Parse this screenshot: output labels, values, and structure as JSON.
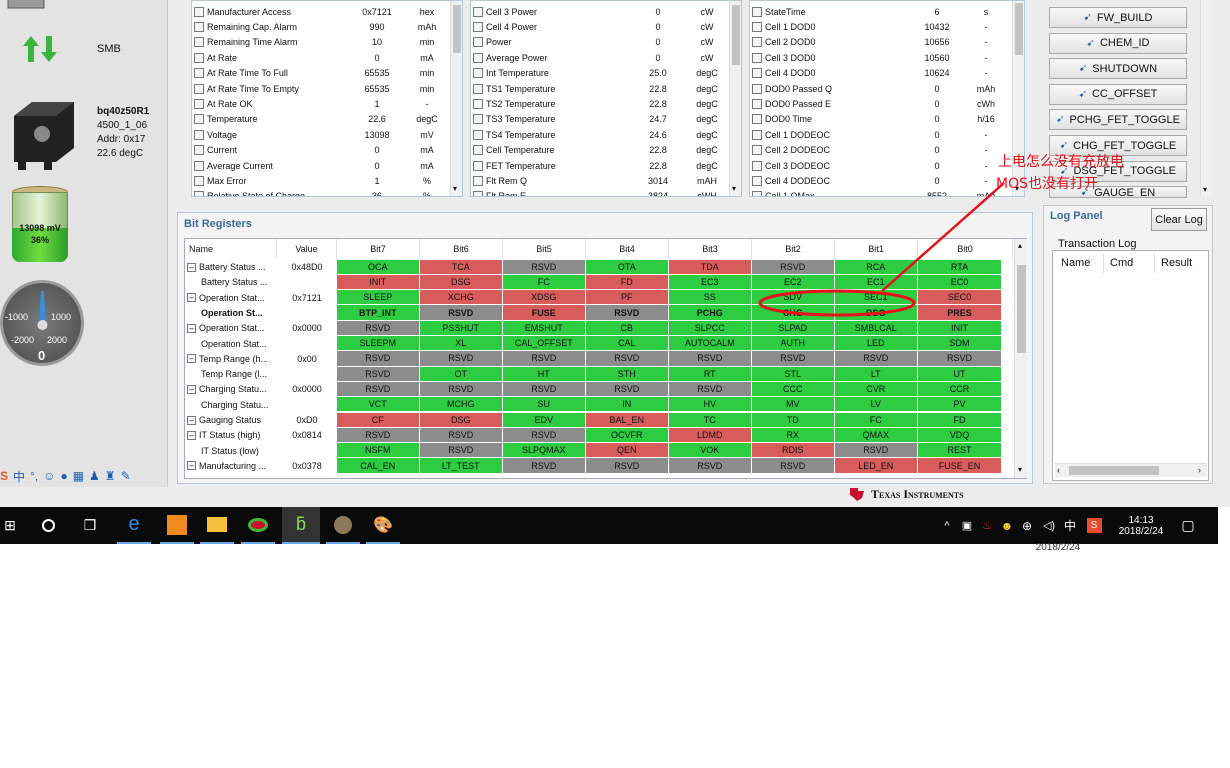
{
  "device": {
    "protocol": "SMB",
    "name": "bq40z50R1",
    "firmware": "4500_1_06",
    "addr": "Addr: 0x17",
    "temp": "22.6 degC",
    "battery_voltage": "13098 mV",
    "battery_soc": "36%",
    "gauge_labels": [
      "-1000",
      "1000",
      "-2000",
      "2000",
      "0"
    ]
  },
  "col1": [
    {
      "name": "Manufacturer Access",
      "value": "0x7121",
      "unit": "hex"
    },
    {
      "name": "Remaining Cap. Alarm",
      "value": "990",
      "unit": "mAh"
    },
    {
      "name": "Remaining Time Alarm",
      "value": "10",
      "unit": "min"
    },
    {
      "name": "At Rate",
      "value": "0",
      "unit": "mA"
    },
    {
      "name": "At Rate Time To Full",
      "value": "65535",
      "unit": "min"
    },
    {
      "name": "At Rate Time To Empty",
      "value": "65535",
      "unit": "min"
    },
    {
      "name": "At Rate OK",
      "value": "1",
      "unit": "-"
    },
    {
      "name": "Temperature",
      "value": "22.6",
      "unit": "degC"
    },
    {
      "name": "Voltage",
      "value": "13098",
      "unit": "mV"
    },
    {
      "name": "Current",
      "value": "0",
      "unit": "mA"
    },
    {
      "name": "Average Current",
      "value": "0",
      "unit": "mA"
    },
    {
      "name": "Max Error",
      "value": "1",
      "unit": "%"
    },
    {
      "name": "Relative State of Charge",
      "value": "36",
      "unit": "%"
    }
  ],
  "col2": [
    {
      "name": "Cell 3 Power",
      "value": "0",
      "unit": "cW"
    },
    {
      "name": "Cell 4 Power",
      "value": "0",
      "unit": "cW"
    },
    {
      "name": "Power",
      "value": "0",
      "unit": "cW"
    },
    {
      "name": "Average Power",
      "value": "0",
      "unit": "cW"
    },
    {
      "name": "Int Temperature",
      "value": "25.0",
      "unit": "degC"
    },
    {
      "name": "TS1 Temperature",
      "value": "22.8",
      "unit": "degC"
    },
    {
      "name": "TS2 Temperature",
      "value": "22.8",
      "unit": "degC"
    },
    {
      "name": "TS3 Temperature",
      "value": "24.7",
      "unit": "degC"
    },
    {
      "name": "TS4 Temperature",
      "value": "24.6",
      "unit": "degC"
    },
    {
      "name": "Cell Temperature",
      "value": "22.8",
      "unit": "degC"
    },
    {
      "name": "FET Temperature",
      "value": "22.8",
      "unit": "degC"
    },
    {
      "name": "Flt Rem Q",
      "value": "3014",
      "unit": "mAH"
    },
    {
      "name": "Flt Rem E",
      "value": "3824",
      "unit": "cWH"
    }
  ],
  "col3": [
    {
      "name": "StateTime",
      "value": "6",
      "unit": "s"
    },
    {
      "name": "Cell 1 DOD0",
      "value": "10432",
      "unit": "-"
    },
    {
      "name": "Cell 2 DOD0",
      "value": "10656",
      "unit": "-"
    },
    {
      "name": "Cell 3 DOD0",
      "value": "10560",
      "unit": "-"
    },
    {
      "name": "Cell 4 DOD0",
      "value": "10624",
      "unit": "-"
    },
    {
      "name": "DOD0 Passed Q",
      "value": "0",
      "unit": "mAh"
    },
    {
      "name": "DOD0 Passed E",
      "value": "0",
      "unit": "cWh"
    },
    {
      "name": "DOD0 Time",
      "value": "0",
      "unit": "h/16"
    },
    {
      "name": "Cell 1 DODEOC",
      "value": "0",
      "unit": "-"
    },
    {
      "name": "Cell 2 DODEOC",
      "value": "0",
      "unit": "-"
    },
    {
      "name": "Cell 3 DODEOC",
      "value": "0",
      "unit": "-"
    },
    {
      "name": "Cell 4 DODEOC",
      "value": "0",
      "unit": "-"
    },
    {
      "name": "Cell 1 QMax",
      "value": "8552",
      "unit": "mAh"
    }
  ],
  "commands": [
    "FW_BUILD",
    "CHEM_ID",
    "SHUTDOWN",
    "CC_OFFSET",
    "PCHG_FET_TOGGLE",
    "CHG_FET_TOGGLE",
    "DSG_FET_TOGGLE",
    "GAUGE_EN"
  ],
  "bit_registers": {
    "title": "Bit Registers",
    "headers": [
      "Name",
      "Value",
      "Bit7",
      "Bit6",
      "Bit5",
      "Bit4",
      "Bit3",
      "Bit2",
      "Bit1",
      "Bit0"
    ],
    "rows": [
      {
        "name": "Battery Status ...",
        "value": "0x48D0",
        "expand": true,
        "bold": false,
        "bits": [
          [
            "OCA",
            "g"
          ],
          [
            "TCA",
            "r"
          ],
          [
            "RSVD",
            "y"
          ],
          [
            "OTA",
            "g"
          ],
          [
            "TDA",
            "r"
          ],
          [
            "RSVD",
            "y"
          ],
          [
            "RCA",
            "g"
          ],
          [
            "RTA",
            "g"
          ]
        ]
      },
      {
        "name": "Battery Status ...",
        "value": "",
        "expand": false,
        "bold": false,
        "bits": [
          [
            "INIT",
            "r"
          ],
          [
            "DSG",
            "r"
          ],
          [
            "FC",
            "g"
          ],
          [
            "FD",
            "r"
          ],
          [
            "EC3",
            "g"
          ],
          [
            "EC2",
            "g"
          ],
          [
            "EC1",
            "g"
          ],
          [
            "EC0",
            "g"
          ]
        ]
      },
      {
        "name": "Operation Stat...",
        "value": "0x7121",
        "expand": true,
        "bold": false,
        "bits": [
          [
            "SLEEP",
            "g"
          ],
          [
            "XCHG",
            "r"
          ],
          [
            "XDSG",
            "r"
          ],
          [
            "PF",
            "r"
          ],
          [
            "SS",
            "g"
          ],
          [
            "SDV",
            "g"
          ],
          [
            "SEC1",
            "g"
          ],
          [
            "SEC0",
            "r"
          ]
        ]
      },
      {
        "name": "Operation St...",
        "value": "",
        "expand": false,
        "bold": true,
        "bits": [
          [
            "BTP_INT",
            "g"
          ],
          [
            "RSVD",
            "y"
          ],
          [
            "FUSE",
            "r"
          ],
          [
            "RSVD",
            "y"
          ],
          [
            "PCHG",
            "g"
          ],
          [
            "CHG",
            "g"
          ],
          [
            "DSG",
            "g"
          ],
          [
            "PRES",
            "r"
          ]
        ]
      },
      {
        "name": "Operation Stat...",
        "value": "0x0000",
        "expand": true,
        "bold": false,
        "bits": [
          [
            "RSVD",
            "y"
          ],
          [
            "PSSHUT",
            "g"
          ],
          [
            "EMSHUT",
            "g"
          ],
          [
            "CB",
            "g"
          ],
          [
            "SLPCC",
            "g"
          ],
          [
            "SLPAD",
            "g"
          ],
          [
            "SMBLCAL",
            "g"
          ],
          [
            "INIT",
            "g"
          ]
        ]
      },
      {
        "name": "Operation Stat...",
        "value": "",
        "expand": false,
        "bold": false,
        "bits": [
          [
            "SLEEPM",
            "g"
          ],
          [
            "XL",
            "g"
          ],
          [
            "CAL_OFFSET",
            "g"
          ],
          [
            "CAL",
            "g"
          ],
          [
            "AUTOCALM",
            "g"
          ],
          [
            "AUTH",
            "g"
          ],
          [
            "LED",
            "g"
          ],
          [
            "SDM",
            "g"
          ]
        ]
      },
      {
        "name": "Temp Range (h...",
        "value": "0x00",
        "expand": true,
        "bold": false,
        "bits": [
          [
            "RSVD",
            "y"
          ],
          [
            "RSVD",
            "y"
          ],
          [
            "RSVD",
            "y"
          ],
          [
            "RSVD",
            "y"
          ],
          [
            "RSVD",
            "y"
          ],
          [
            "RSVD",
            "y"
          ],
          [
            "RSVD",
            "y"
          ],
          [
            "RSVD",
            "y"
          ]
        ]
      },
      {
        "name": "Temp Range (l...",
        "value": "",
        "expand": false,
        "bold": false,
        "bits": [
          [
            "RSVD",
            "y"
          ],
          [
            "OT",
            "g"
          ],
          [
            "HT",
            "g"
          ],
          [
            "STH",
            "g"
          ],
          [
            "RT",
            "g"
          ],
          [
            "STL",
            "g"
          ],
          [
            "LT",
            "g"
          ],
          [
            "UT",
            "g"
          ]
        ]
      },
      {
        "name": "Charging Statu...",
        "value": "0x0000",
        "expand": true,
        "bold": false,
        "bits": [
          [
            "RSVD",
            "y"
          ],
          [
            "RSVD",
            "y"
          ],
          [
            "RSVD",
            "y"
          ],
          [
            "RSVD",
            "y"
          ],
          [
            "RSVD",
            "y"
          ],
          [
            "CCC",
            "g"
          ],
          [
            "CVR",
            "g"
          ],
          [
            "CCR",
            "g"
          ]
        ]
      },
      {
        "name": "Charging Statu...",
        "value": "",
        "expand": false,
        "bold": false,
        "bits": [
          [
            "VCT",
            "g"
          ],
          [
            "MCHG",
            "g"
          ],
          [
            "SU",
            "g"
          ],
          [
            "IN",
            "g"
          ],
          [
            "HV",
            "g"
          ],
          [
            "MV",
            "g"
          ],
          [
            "LV",
            "g"
          ],
          [
            "PV",
            "g"
          ]
        ]
      },
      {
        "name": "Gauging Status",
        "value": "0xD0",
        "expand": true,
        "bold": false,
        "bits": [
          [
            "CF",
            "r"
          ],
          [
            "DSG",
            "r"
          ],
          [
            "EDV",
            "g"
          ],
          [
            "BAL_EN",
            "r"
          ],
          [
            "TC",
            "g"
          ],
          [
            "TD",
            "g"
          ],
          [
            "FC",
            "g"
          ],
          [
            "FD",
            "g"
          ]
        ]
      },
      {
        "name": "IT Status (high)",
        "value": "0x0814",
        "expand": true,
        "bold": false,
        "bits": [
          [
            "RSVD",
            "y"
          ],
          [
            "RSVD",
            "y"
          ],
          [
            "RSVD",
            "y"
          ],
          [
            "OCVFR",
            "g"
          ],
          [
            "LDMD",
            "r"
          ],
          [
            "RX",
            "g"
          ],
          [
            "QMAX",
            "g"
          ],
          [
            "VDQ",
            "g"
          ]
        ]
      },
      {
        "name": "IT Status (low)",
        "value": "",
        "expand": false,
        "bold": false,
        "bits": [
          [
            "NSFM",
            "g"
          ],
          [
            "RSVD",
            "y"
          ],
          [
            "SLPQMAX",
            "g"
          ],
          [
            "QEN",
            "r"
          ],
          [
            "VOK",
            "g"
          ],
          [
            "RDIS",
            "r"
          ],
          [
            "RSVD",
            "y"
          ],
          [
            "REST",
            "g"
          ]
        ]
      },
      {
        "name": "Manufacturing ...",
        "value": "0x0378",
        "expand": true,
        "bold": false,
        "bits": [
          [
            "CAL_EN",
            "g"
          ],
          [
            "LT_TEST",
            "g"
          ],
          [
            "RSVD",
            "y"
          ],
          [
            "RSVD",
            "y"
          ],
          [
            "RSVD",
            "y"
          ],
          [
            "RSVD",
            "y"
          ],
          [
            "LED_EN",
            "r"
          ],
          [
            "FUSE_EN",
            "r"
          ]
        ]
      }
    ]
  },
  "annotation": {
    "line1": "上电怎么没有充放电",
    "line2": "MOS也没有打开"
  },
  "log_panel": {
    "title": "Log Panel",
    "clear_button": "Clear Log",
    "section": "Transaction Log",
    "columns": [
      "Name",
      "Cmd",
      "Result"
    ]
  },
  "brand": "Texas Instruments",
  "taskbar": {
    "time": "14:13",
    "date": "2018/2/24",
    "date_ghost": "2018/2/24",
    "ime": "中"
  },
  "colors": {
    "green": "#2ecc40",
    "red": "#d95c5c",
    "gray": "#8c8c8c",
    "annotation": "#e8101a"
  }
}
